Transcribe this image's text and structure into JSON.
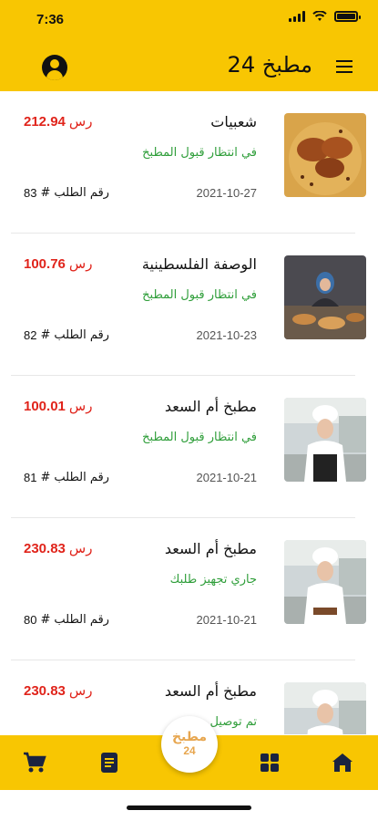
{
  "status_bar": {
    "time": "7:36"
  },
  "header": {
    "title": "مطبخ 24",
    "menu_icon": "menu-icon",
    "profile_icon": "account-circle-icon"
  },
  "orders": [
    {
      "kitchen": "شعبيات",
      "price": "212.94",
      "currency": "رس",
      "status": "في انتظار قبول المطبخ",
      "date": "2021-10-27",
      "order_label": "رقم الطلب",
      "order_hash": "#",
      "order_number": "83",
      "image": "dish-rice-chicken"
    },
    {
      "kitchen": "الوصفة الفلسطينية",
      "price": "100.76",
      "currency": "رس",
      "status": "في انتظار قبول المطبخ",
      "date": "2021-10-23",
      "order_label": "رقم الطلب",
      "order_hash": "#",
      "order_number": "82",
      "image": "woman-cook-table"
    },
    {
      "kitchen": "مطبخ أم السعد",
      "price": "100.01",
      "currency": "رس",
      "status": "في انتظار قبول المطبخ",
      "date": "2021-10-21",
      "order_label": "رقم الطلب",
      "order_hash": "#",
      "order_number": "81",
      "image": "chef-woman"
    },
    {
      "kitchen": "مطبخ أم السعد",
      "price": "230.83",
      "currency": "رس",
      "status": "جاري تجهيز طلبك",
      "date": "2021-10-21",
      "order_label": "رقم الطلب",
      "order_hash": "#",
      "order_number": "80",
      "image": "chef-woman"
    },
    {
      "kitchen": "مطبخ أم السعد",
      "price": "230.83",
      "currency": "رس",
      "status": "تم توصيل",
      "date": "",
      "order_label": "",
      "order_hash": "",
      "order_number": "",
      "image": "chef-woman"
    }
  ],
  "tabbar": {
    "items": [
      "home-icon",
      "grid-icon",
      "orders-icon",
      "cart-icon"
    ],
    "center_logo": {
      "text": "مطبخ",
      "number": "24"
    }
  },
  "colors": {
    "brand": "#f8c602",
    "price": "#e0241b",
    "status": "#2f9e3a",
    "tab_icon": "#1a2340"
  }
}
